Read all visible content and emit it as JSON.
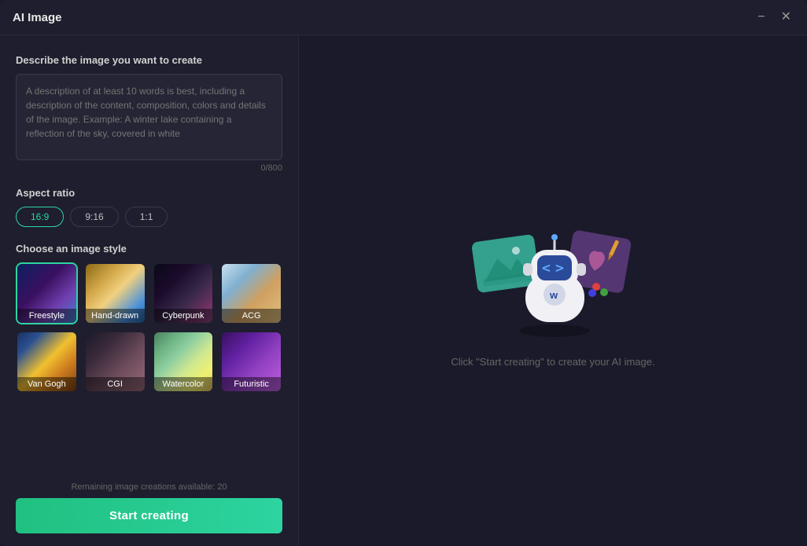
{
  "window": {
    "title": "AI Image",
    "minimize_label": "−",
    "close_label": "✕"
  },
  "left_panel": {
    "description_label": "Describe the image you want to create",
    "description_placeholder": "A description of at least 10 words is best, including a description of the content, composition, colors and details of the image. Example: A winter lake containing a reflection of the sky, covered in white",
    "char_count": "0/800",
    "aspect_ratio_label": "Aspect ratio",
    "aspect_ratios": [
      {
        "label": "16:9",
        "active": true
      },
      {
        "label": "9:16",
        "active": false
      },
      {
        "label": "1:1",
        "active": false
      }
    ],
    "style_label": "Choose an image style",
    "styles": [
      {
        "id": "freestyle",
        "label": "Freestyle",
        "bg_class": "bg-freestyle",
        "selected": true
      },
      {
        "id": "hand-drawn",
        "label": "Hand-drawn",
        "bg_class": "bg-hand-drawn",
        "selected": false
      },
      {
        "id": "cyberpunk",
        "label": "Cyberpunk",
        "bg_class": "bg-cyberpunk",
        "selected": false
      },
      {
        "id": "acg",
        "label": "ACG",
        "bg_class": "bg-acg",
        "selected": false
      },
      {
        "id": "van-gogh",
        "label": "Van Gogh",
        "bg_class": "bg-van-gogh",
        "selected": false
      },
      {
        "id": "cgi",
        "label": "CGI",
        "bg_class": "bg-cgi",
        "selected": false
      },
      {
        "id": "watercolor",
        "label": "Watercolor",
        "bg_class": "bg-watercolor",
        "selected": false
      },
      {
        "id": "futuristic",
        "label": "Futuristic",
        "bg_class": "bg-futuristic",
        "selected": false
      }
    ],
    "remaining_text": "Remaining image creations available: 20",
    "start_button_label": "Start creating"
  },
  "right_panel": {
    "placeholder_text": "Click \"Start creating\" to create your AI image."
  }
}
